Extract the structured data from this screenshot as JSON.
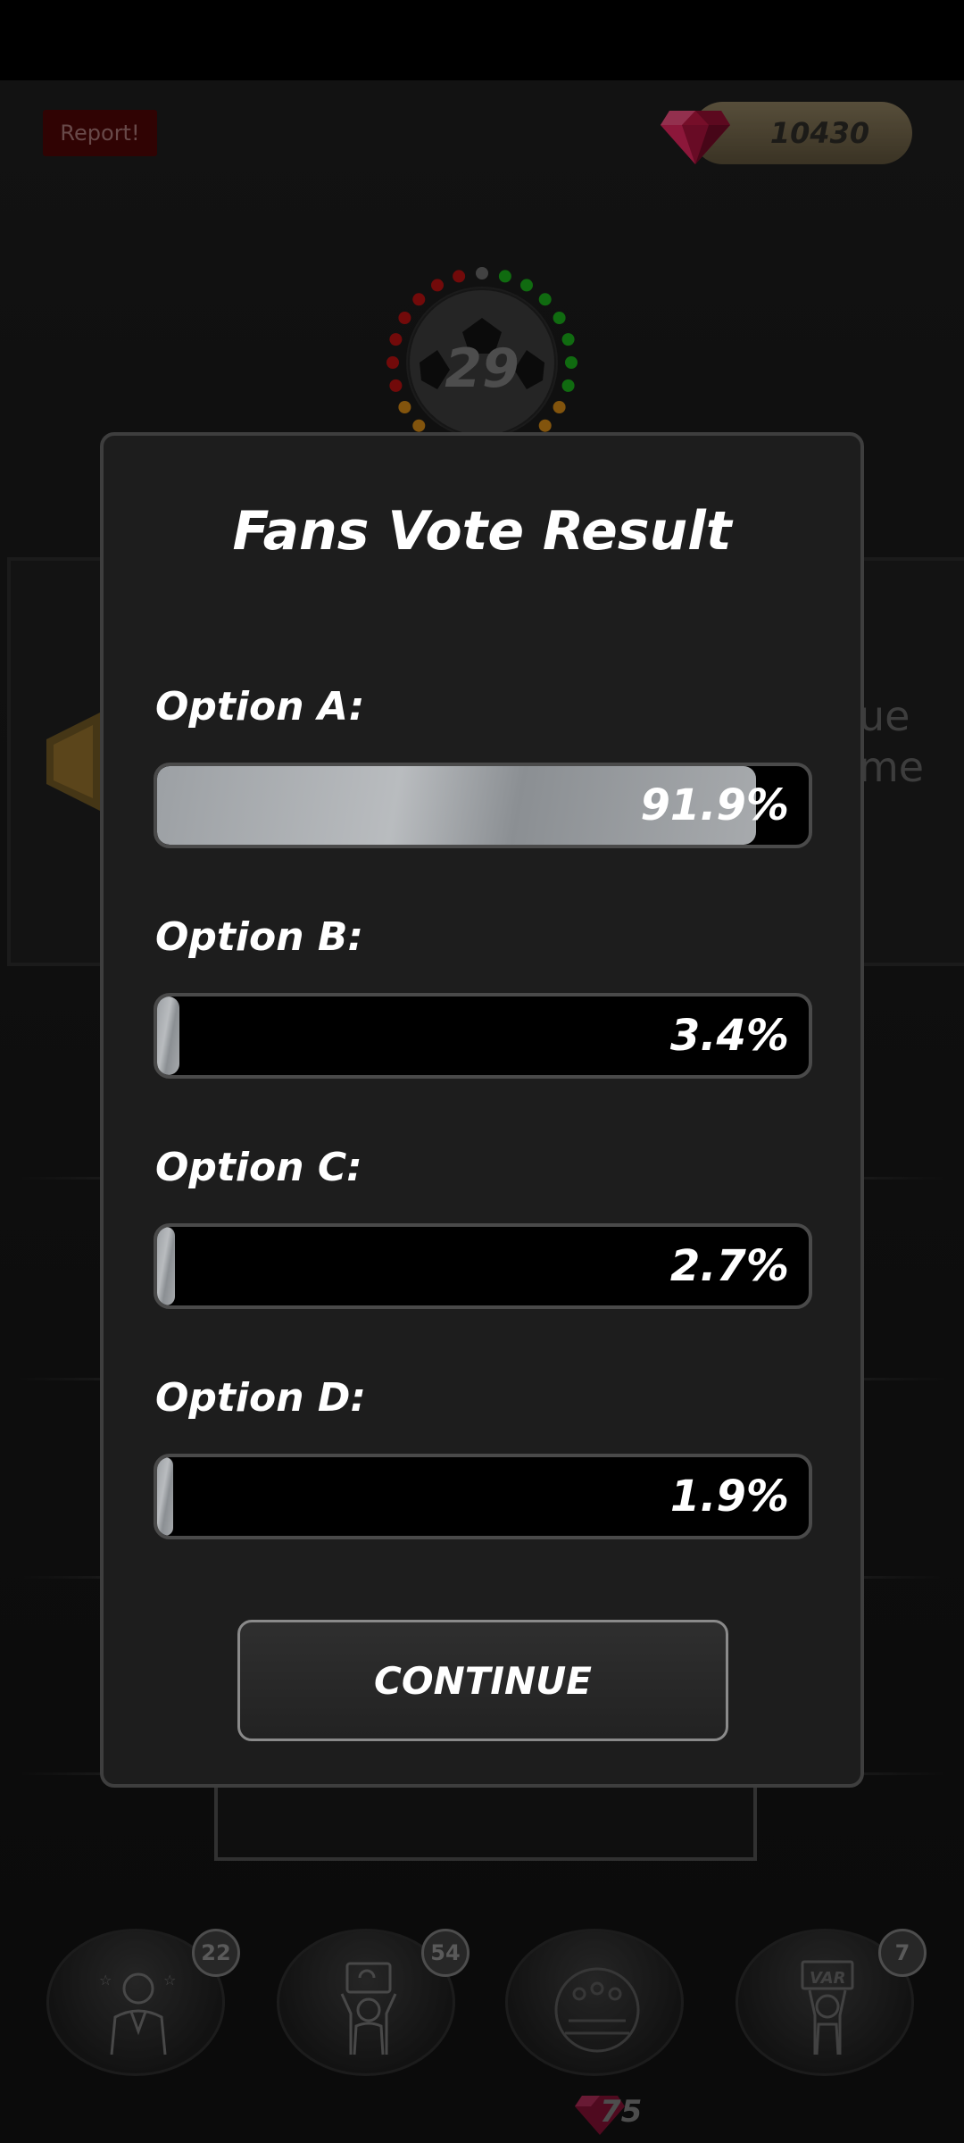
{
  "header": {
    "report_label": "Report!",
    "gems": "10430"
  },
  "timer": {
    "value": "29"
  },
  "background": {
    "side_text_line1": "ue",
    "side_text_line2": "me"
  },
  "modal": {
    "title": "Fans Vote Result",
    "options": [
      {
        "label": "Option A:",
        "percent_text": "91.9%",
        "value": 91.9
      },
      {
        "label": "Option B:",
        "percent_text": "3.4%",
        "value": 3.4
      },
      {
        "label": "Option C:",
        "percent_text": "2.7%",
        "value": 2.7
      },
      {
        "label": "Option D:",
        "percent_text": "1.9%",
        "value": 1.9
      }
    ],
    "continue_label": "CONTINUE"
  },
  "bottom_bar": {
    "items": [
      {
        "icon": "celebrity-icon",
        "badge": "22"
      },
      {
        "icon": "fan-sign-icon",
        "badge": "54"
      },
      {
        "icon": "crowd-icon",
        "badge": ""
      },
      {
        "icon": "var-icon",
        "badge": "7"
      }
    ],
    "cost": "75"
  },
  "colors": {
    "gem": "#c21a4a",
    "timer_green": "#1aa51a",
    "timer_red": "#b01010",
    "timer_orange": "#c88214"
  }
}
